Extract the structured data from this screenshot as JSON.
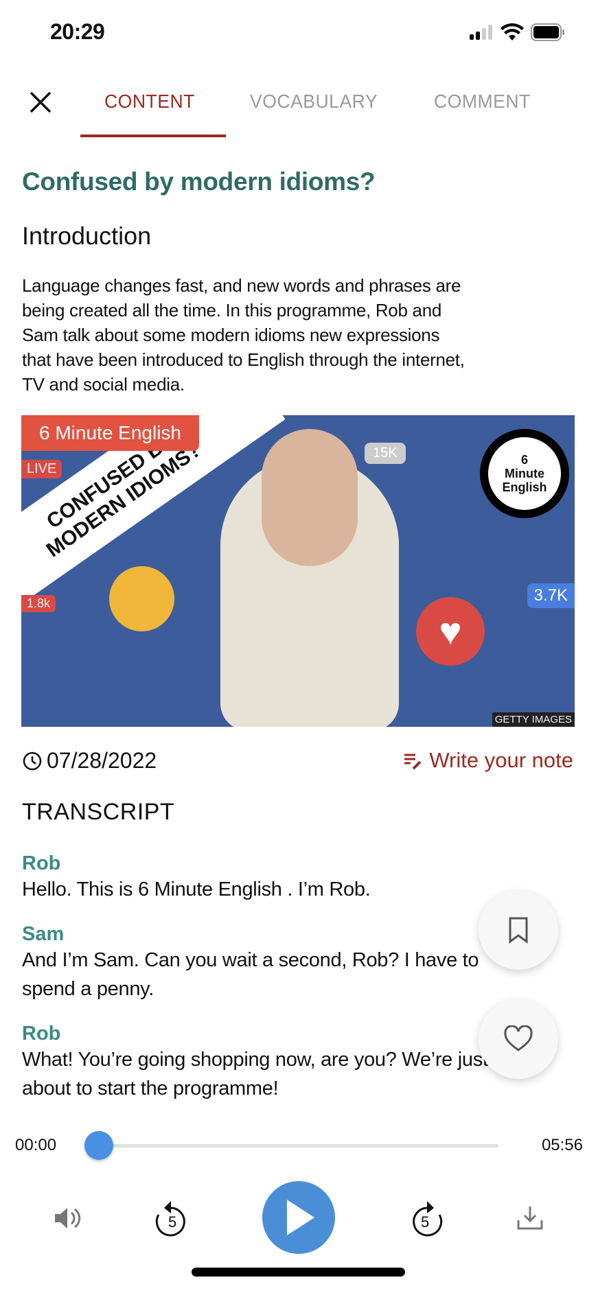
{
  "status_bar": {
    "time": "20:29"
  },
  "tabs": [
    {
      "label": "CONTENT",
      "active": true
    },
    {
      "label": "VOCABULARY",
      "active": false
    },
    {
      "label": "COMMENT",
      "active": false
    }
  ],
  "article": {
    "title": "Confused by modern idioms?",
    "section_heading": "Introduction",
    "intro_lines": [
      "Language changes fast, and new words and phrases are",
      "being created all the time. In this programme, Rob and",
      "Sam talk about some modern idioms   new expressions",
      "that have been introduced to English through the internet,",
      "TV and social media."
    ],
    "image": {
      "badge": "6 Minute English",
      "banner_line1": "CONFUSED BY",
      "banner_line2": "MODERN IDIOMS?",
      "logo_line1": "Minute",
      "logo_line2": "English",
      "logo_number": "6",
      "credit": "GETTY IMAGES",
      "bubbles": [
        "LIVE",
        "15K",
        "1.8k",
        "3.7K"
      ]
    },
    "date": "07/28/2022",
    "note_label": "Write your note",
    "transcript_heading": "TRANSCRIPT",
    "transcript": [
      {
        "speaker": "Rob",
        "lines": [
          "Hello. This is 6 Minute English . I’m Rob."
        ]
      },
      {
        "speaker": "Sam",
        "lines": [
          "And I’m Sam.  Can you wait a second, Rob? I have to",
          "spend a penny."
        ]
      },
      {
        "speaker": "Rob",
        "lines": [
          "What! You’re going shopping now, are you? We’re just",
          "about to start the programme!"
        ]
      }
    ]
  },
  "player": {
    "current_time": "00:00",
    "duration": "05:56",
    "progress": 0,
    "skip_back_seconds": "5",
    "skip_forward_seconds": "5"
  },
  "colors": {
    "accent": "#9b2a20",
    "title": "#2f6b64",
    "speaker": "#3a8a86",
    "player": "#4a8fd6"
  }
}
